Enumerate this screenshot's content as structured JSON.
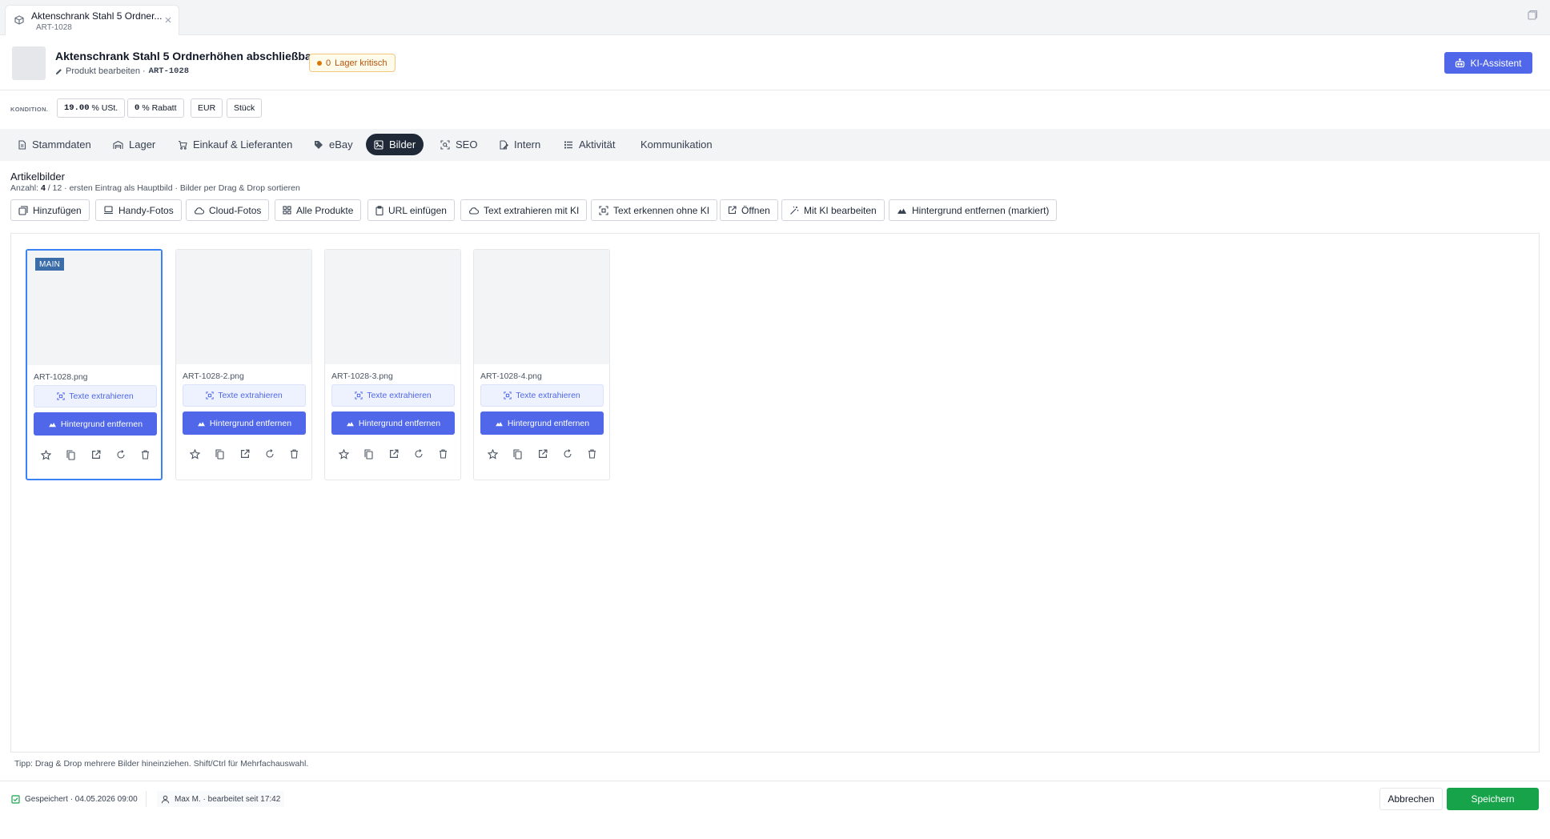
{
  "window_tab": {
    "title": "Aktenschrank Stahl 5 Ordner...",
    "subtitle": "ART-1028"
  },
  "header": {
    "title": "Aktenschrank Stahl 5 Ordnerhöhen abschließbar",
    "edit_label": "Produkt bearbeiten ·",
    "sku": "ART-1028",
    "stock_count": "0",
    "stock_label": "Lager kritisch",
    "ai_button": "KI-Assistent"
  },
  "conditions": {
    "label": "KONDITION.",
    "vat_value": "19.00",
    "vat_unit": "% USt.",
    "discount_value": "0",
    "discount_unit": "% Rabatt",
    "currency": "EUR",
    "unit": "Stück"
  },
  "tabs": [
    {
      "label": "Stammdaten",
      "icon": "document-icon"
    },
    {
      "label": "Lager",
      "icon": "warehouse-icon"
    },
    {
      "label": "Einkauf & Lieferanten",
      "icon": "cart-icon"
    },
    {
      "label": "eBay",
      "icon": "tag-icon"
    },
    {
      "label": "Bilder",
      "icon": "images-icon",
      "active": true
    },
    {
      "label": "SEO",
      "icon": "seo-icon"
    },
    {
      "label": "Intern",
      "icon": "note-icon"
    },
    {
      "label": "Aktivität",
      "icon": "activity-icon"
    },
    {
      "label": "Kommunikation",
      "icon": ""
    }
  ],
  "section": {
    "title": "Artikelbilder",
    "count_prefix": "Anzahl:",
    "count": "4",
    "count_suffix": "/ 12 · ersten Eintrag als Hauptbild · Bilder per Drag & Drop sortieren"
  },
  "toolbar": [
    {
      "label": "Hinzufügen",
      "icon": "add-image-icon"
    },
    {
      "label": "Handy-Fotos",
      "icon": "devices-icon"
    },
    {
      "label": "Cloud-Fotos",
      "icon": "cloud-icon"
    },
    {
      "label": "Alle Produkte",
      "icon": "grid-icon"
    },
    {
      "label": "URL einfügen",
      "icon": "clipboard-icon"
    },
    {
      "label": "Text extrahieren mit KI",
      "icon": "cloud-icon"
    },
    {
      "label": "Text erkennen ohne KI",
      "icon": "scan-icon"
    },
    {
      "label": "Öffnen",
      "icon": "external-link-icon"
    },
    {
      "label": "Mit KI bearbeiten",
      "icon": "magic-wand-icon"
    },
    {
      "label": "Hintergrund entfernen (markiert)",
      "icon": "mountain-icon"
    }
  ],
  "images": [
    {
      "filename": "ART-1028.png",
      "main": true
    },
    {
      "filename": "ART-1028-2.png",
      "main": false
    },
    {
      "filename": "ART-1028-3.png",
      "main": false
    },
    {
      "filename": "ART-1028-4.png",
      "main": false
    }
  ],
  "card_labels": {
    "main_tag": "MAIN",
    "extract": "Texte extrahieren",
    "remove_bg": "Hintergrund entfernen"
  },
  "tip": "Tipp: Drag & Drop mehrere Bilder hineinziehen. Shift/Ctrl für Mehrfachauswahl.",
  "footer": {
    "saved": "Gespeichert · 04.05.2026 09:00",
    "user": "Max M. · bearbeitet seit 17:42",
    "cancel": "Abbrechen",
    "save": "Speichern"
  },
  "colors": {
    "primary": "#4f67e8",
    "active_tab": "#1f2937",
    "save": "#16a34a",
    "warning": "#d97706",
    "main_border": "#3b82f6"
  }
}
